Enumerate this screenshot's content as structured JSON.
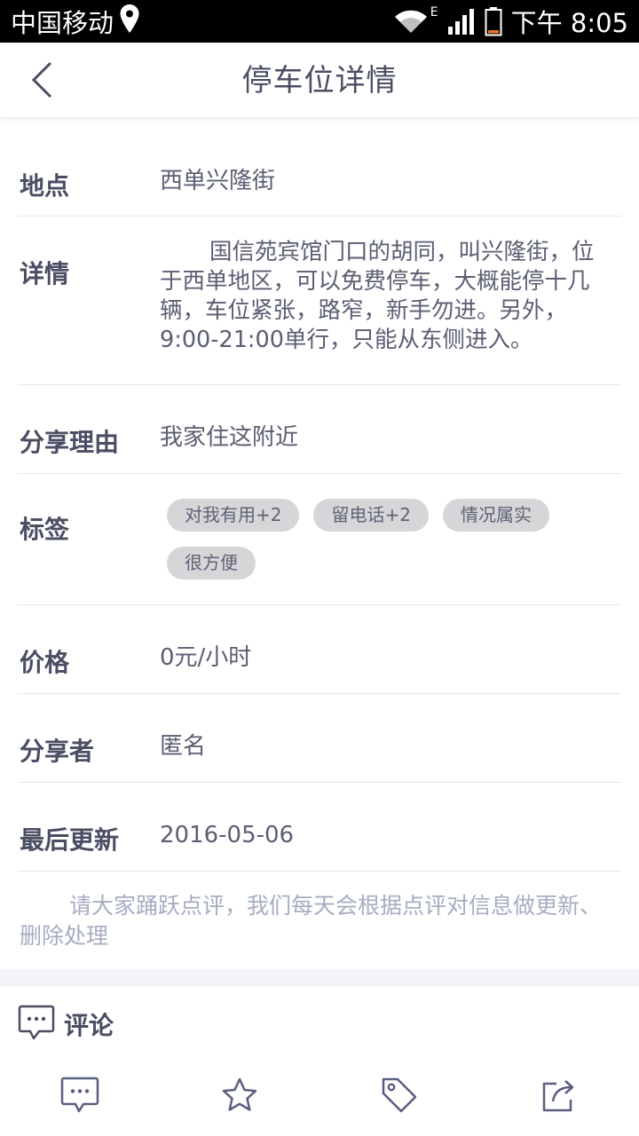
{
  "status_bar": {
    "carrier": "中国移动",
    "network_type": "E",
    "time": "下午 8:05",
    "icons": [
      "location-icon",
      "wifi-icon",
      "signal-icon",
      "battery-icon"
    ]
  },
  "nav": {
    "title": "停车位详情",
    "back_icon": "chevron-left-icon"
  },
  "details": {
    "location": {
      "label": "地点",
      "value": "西单兴隆街"
    },
    "description": {
      "label": "详情",
      "value": "国信苑宾馆门口的胡同，叫兴隆街，位于西单地区，可以免费停车，大概能停十几辆，车位紧张，路窄，新手勿进。另外，9:00-21:00单行，只能从东侧进入。"
    },
    "reason": {
      "label": "分享理由",
      "value": "我家住这附近"
    },
    "tags": {
      "label": "标签",
      "items": [
        "对我有用+2",
        "留电话+2",
        "情况属实",
        "很方便"
      ]
    },
    "price": {
      "label": "价格",
      "value": "0元/小时"
    },
    "sharer": {
      "label": "分享者",
      "value": "匿名"
    },
    "updated": {
      "label": "最后更新",
      "value": "2016-05-06"
    }
  },
  "notice": "请大家踊跃点评，我们每天会根据点评对信息做更新、删除处理",
  "comments": {
    "title": "评论",
    "icon": "chat-bubble-icon"
  },
  "toolbar": {
    "items": [
      "comment-icon",
      "star-icon",
      "tag-icon",
      "share-icon"
    ]
  },
  "colors": {
    "text_primary": "#4a4e63",
    "text_muted": "#a6adc2",
    "chip_bg": "#d6d6d8",
    "divider": "#e4e6ea"
  }
}
